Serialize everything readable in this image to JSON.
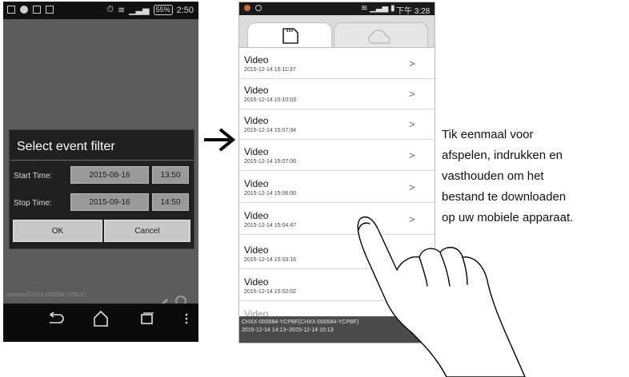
{
  "left_phone": {
    "status": {
      "battery": "55%",
      "time": "2:50"
    },
    "dialog": {
      "title": "Select event filter",
      "start_label": "Start Time:",
      "start_date": "2015-08-16",
      "start_time": "13:50",
      "stop_label": "Stop Time:",
      "stop_date": "2015-09-16",
      "stop_time": "14:50",
      "ok_label": "OK",
      "cancel_label": "Cancel"
    },
    "bottom_text": "xxxxxxx(CGXX-000058-UZBLF)",
    "nav_icons": [
      "back-icon",
      "home-icon",
      "recent-apps-icon",
      "menu-icon"
    ]
  },
  "right_phone": {
    "status": {
      "time": "下午 3:28"
    },
    "tabs": [
      "sd-card-icon",
      "cloud-icon"
    ],
    "items": [
      {
        "title": "Video",
        "date": "2015-12-14 15:11:37",
        "chevron": ">"
      },
      {
        "title": "Video",
        "date": "2015-12-14 15:10:03",
        "chevron": ">"
      },
      {
        "title": "Video",
        "date": "2015-12-14 15:07:34",
        "chevron": ">"
      },
      {
        "title": "Video",
        "date": "2015-12-14 15:07:06",
        "chevron": ">"
      },
      {
        "title": "Video",
        "date": "2015-12-14 15:06:00",
        "chevron": ">"
      },
      {
        "title": "Video",
        "date": "2015-12-14 15:04:47",
        "chevron": ">"
      },
      {
        "title": "Video",
        "date": "2015-12-14 15:03:16",
        "chevron": ""
      },
      {
        "title": "Video",
        "date": "2015-12-14 15:02:02",
        "chevron": ""
      },
      {
        "title": "Video",
        "date": "",
        "chevron": ""
      }
    ],
    "info_line1": "CHXX-000584-YCPBF(CHXX-000584-YCPBF)",
    "info_line2": "2015-12-14 14:13~2015-12-14 15:13"
  },
  "caption_lines": [
    "Tik eenmaal voor",
    "afspelen, indrukken en",
    "vasthouden om het",
    "bestand te downloaden",
    "op uw mobiele apparaat."
  ]
}
